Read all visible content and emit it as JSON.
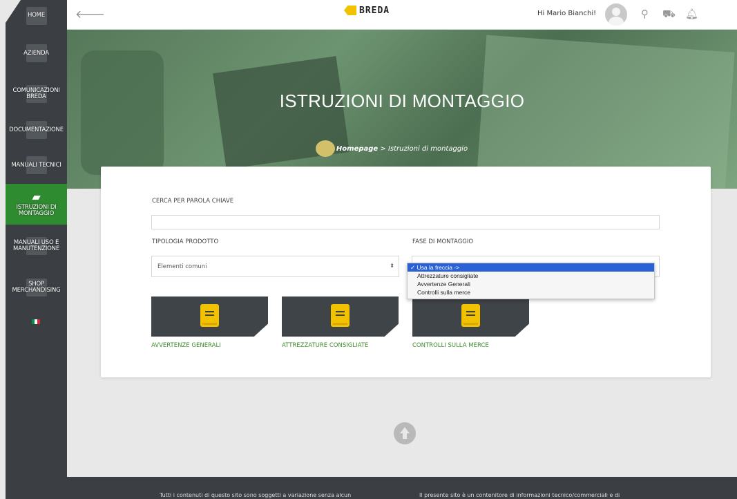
{
  "sidebar": {
    "items": [
      {
        "label": "HOME"
      },
      {
        "label": "AZIENDA"
      },
      {
        "label": "COMUNICAZIONI BREDA"
      },
      {
        "label": "DOCUMENTAZIONE"
      },
      {
        "label": "MANUALI TECNICI"
      },
      {
        "label": "ISTRUZIONI DI MONTAGGIO"
      },
      {
        "label": "MANUALI USO E MANUTENZIONE"
      },
      {
        "label": "SHOP MERCHANDISING"
      }
    ],
    "active": "ISTRUZIONI DI MONTAGGIO",
    "language_flag_colors": [
      "#009246",
      "#ffffff",
      "#ce2b37"
    ]
  },
  "header": {
    "back_icon": "arrow-left-icon",
    "logo_word": "BREDA",
    "greeting": "Hi Mario Bianchi!",
    "icons": [
      "search-icon",
      "cart-icon",
      "bell-icon"
    ]
  },
  "hero": {
    "title": "ISTRUZIONI DI MONTAGGIO",
    "breadcrumb_home": "Homepage",
    "breadcrumb_sep": " > ",
    "breadcrumb_current": "Istruzioni di montaggio"
  },
  "search": {
    "label": "CERCA PER PAROLA CHIAVE",
    "value": ""
  },
  "filters": {
    "tipologia_label": "TIPOLOGIA PRODOTTO",
    "tipologia_value": "Elementi comuni",
    "fase_label": "FASE DI MONTAGGIO",
    "fase_options": [
      {
        "label": "✓ Usa la freccia ->",
        "selected": true
      },
      {
        "label": "Attrezzature consigliate",
        "selected": false
      },
      {
        "label": "Avvertenze Generali",
        "selected": false
      },
      {
        "label": "Controlli sulla merce",
        "selected": false
      }
    ]
  },
  "documents": [
    {
      "label": "AVVERTENZE GENERALI"
    },
    {
      "label": "ATTREZZATURE CONSIGLIATE"
    },
    {
      "label": "CONTROLLI SULLA MERCE"
    }
  ],
  "footer": {
    "left_text": "Tutti i contenuti di questo sito sono soggetti a variazione senza alcun",
    "right_text": "Il presente sito è un contenitore di informazioni tecnico/commerciali e di"
  },
  "colors": {
    "accent_green": "#2e8b2f",
    "sidebar_dark": "#3b3f44",
    "book_yellow": "#f2c200",
    "link_green": "#3e8e2a"
  }
}
